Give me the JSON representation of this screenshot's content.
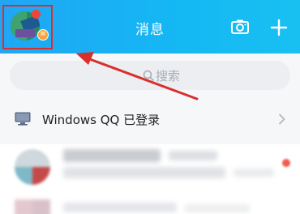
{
  "header": {
    "title": "消息",
    "avatar_badge": "≡",
    "camera_icon": "camera-icon",
    "plus_icon": "plus-icon"
  },
  "search": {
    "placeholder": "搜索",
    "icon": "search-icon"
  },
  "device_row": {
    "label": "Windows QQ 已登录",
    "icon": "monitor-icon",
    "chevron": "chevron-right-icon"
  },
  "annotation": {
    "highlight_color": "#d8302d",
    "arrow_color": "#d8302d"
  },
  "colors": {
    "header_blue": "#1fa8f5",
    "background": "#f6f7f9",
    "badge_orange": "#f6a53a",
    "unread_red": "#f25b4f"
  }
}
